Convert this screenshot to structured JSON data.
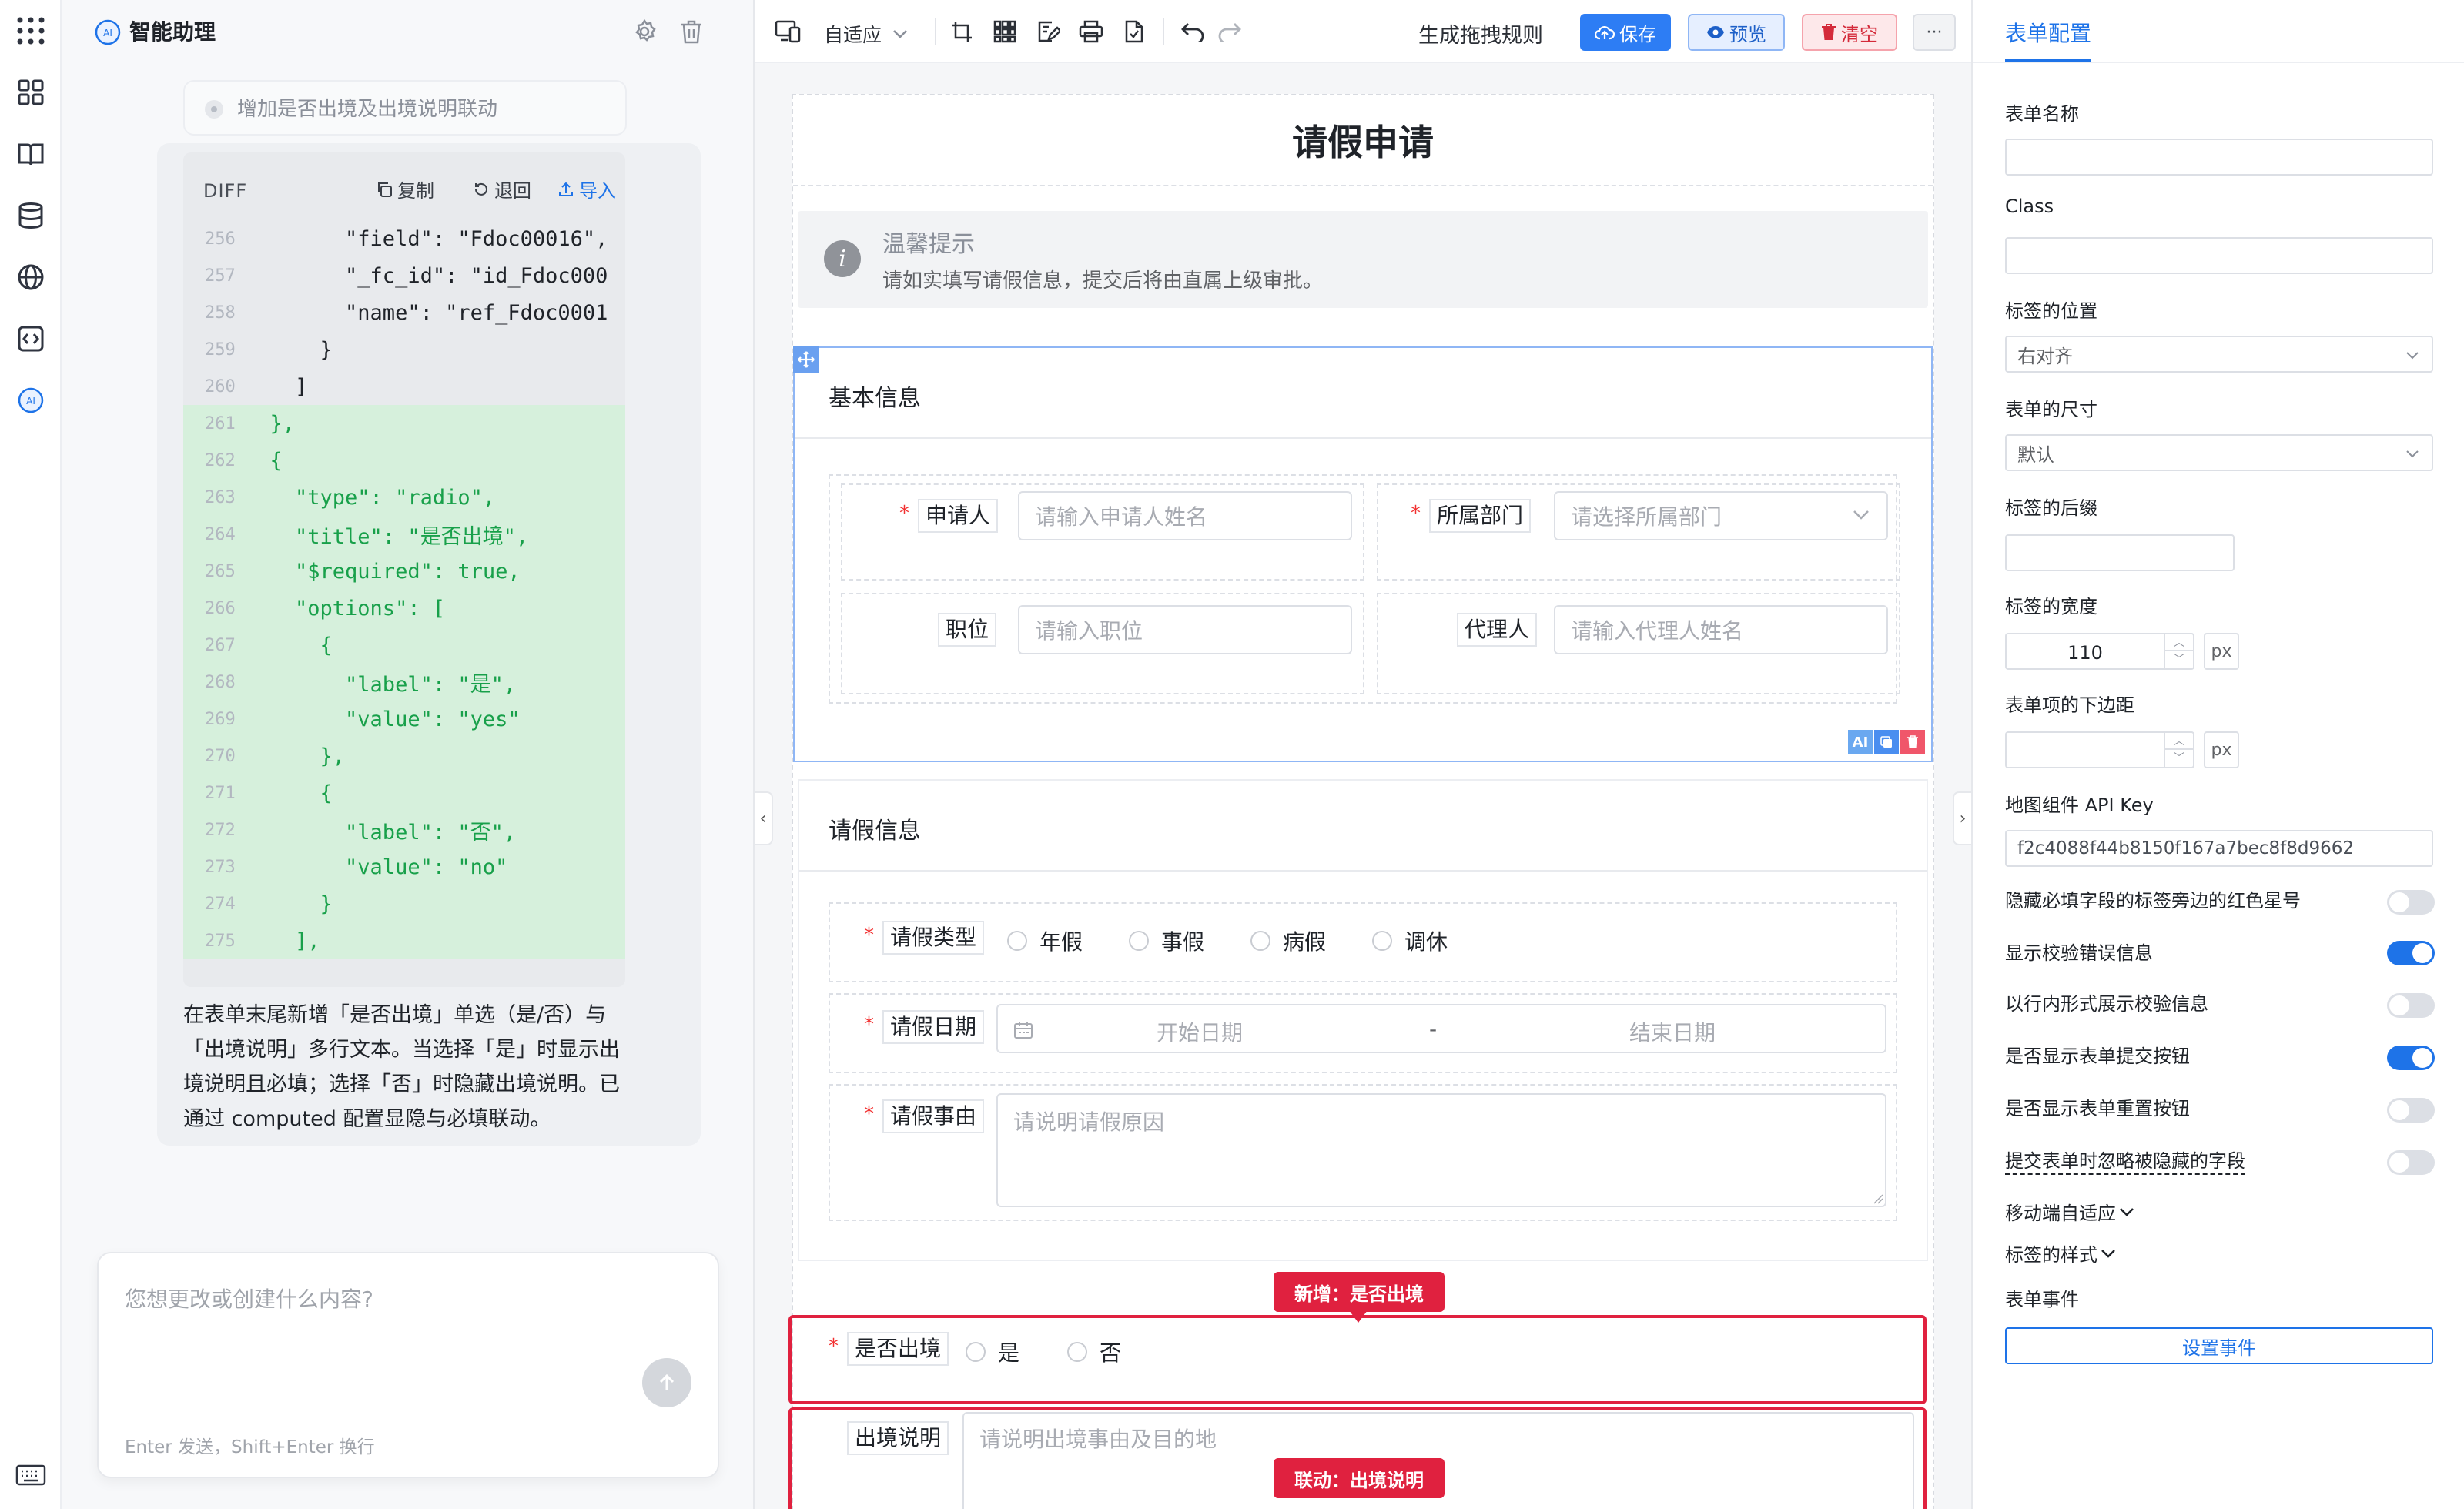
{
  "assistant": {
    "title": "智能助理",
    "prev_prompt": "增加是否出境及出境说明联动",
    "diff": {
      "label": "DIFF",
      "copy": "复制",
      "revert": "退回",
      "import": "导入",
      "lines": [
        {
          "n": "256",
          "t": "        \"field\": \"Fdoc00016\",",
          "added": false
        },
        {
          "n": "257",
          "t": "        \"_fc_id\": \"id_Fdoc000",
          "added": false
        },
        {
          "n": "258",
          "t": "        \"name\": \"ref_Fdoc0001",
          "added": false
        },
        {
          "n": "259",
          "t": "      }",
          "added": false
        },
        {
          "n": "260",
          "t": "    ]",
          "added": false
        },
        {
          "n": "261",
          "t": "  },",
          "added": true
        },
        {
          "n": "262",
          "t": "  {",
          "added": true
        },
        {
          "n": "263",
          "t": "    \"type\": \"radio\",",
          "added": true
        },
        {
          "n": "264",
          "t": "    \"title\": \"是否出境\",",
          "added": true
        },
        {
          "n": "265",
          "t": "    \"$required\": true,",
          "added": true
        },
        {
          "n": "266",
          "t": "    \"options\": [",
          "added": true
        },
        {
          "n": "267",
          "t": "      {",
          "added": true
        },
        {
          "n": "268",
          "t": "        \"label\": \"是\",",
          "added": true
        },
        {
          "n": "269",
          "t": "        \"value\": \"yes\"",
          "added": true
        },
        {
          "n": "270",
          "t": "      },",
          "added": true
        },
        {
          "n": "271",
          "t": "      {",
          "added": true
        },
        {
          "n": "272",
          "t": "        \"label\": \"否\",",
          "added": true
        },
        {
          "n": "273",
          "t": "        \"value\": \"no\"",
          "added": true
        },
        {
          "n": "274",
          "t": "      }",
          "added": true
        },
        {
          "n": "275",
          "t": "    ],",
          "added": true
        }
      ]
    },
    "message": "在表单末尾新增「是否出境」单选（是/否）与「出境说明」多行文本。当选择「是」时显示出境说明且必填；选择「否」时隐藏出境说明。已通过 computed 配置显隐与必填联动。",
    "input_placeholder": "您想更改或创建什么内容?",
    "input_hint": "Enter 发送，Shift+Enter 换行"
  },
  "toolbar": {
    "adapt": "自适应",
    "rule": "生成拖拽规则",
    "save": "保存",
    "preview": "预览",
    "clear": "清空",
    "more": "···"
  },
  "form": {
    "title": "请假申请",
    "tip_title": "温馨提示",
    "tip_text": "请如实填写请假信息，提交后将由直属上级审批。",
    "section1": "基本信息",
    "applicant_label": "申请人",
    "applicant_ph": "请输入申请人姓名",
    "dept_label": "所属部门",
    "dept_ph": "请选择所属部门",
    "position_label": "职位",
    "position_ph": "请输入职位",
    "agent_label": "代理人",
    "agent_ph": "请输入代理人姓名",
    "section2": "请假信息",
    "type_label": "请假类型",
    "type_options": [
      "年假",
      "事假",
      "病假",
      "调休"
    ],
    "date_label": "请假日期",
    "date_start": "开始日期",
    "date_sep": "-",
    "date_end": "结束日期",
    "reason_label": "请假事由",
    "reason_ph": "请说明请假原因",
    "badge_new": "新增：是否出境",
    "abroad_label": "是否出境",
    "abroad_yes": "是",
    "abroad_no": "否",
    "abroad_desc_label": "出境说明",
    "abroad_desc_ph": "请说明出境事由及目的地",
    "badge_link": "联动：出境说明",
    "tool_ai": "AI"
  },
  "props": {
    "tab": "表单配置",
    "form_name": "表单名称",
    "class": "Class",
    "label_pos": "标签的位置",
    "label_pos_val": "右对齐",
    "form_size": "表单的尺寸",
    "form_size_val": "默认",
    "label_suffix": "标签的后缀",
    "label_width": "标签的宽度",
    "label_width_val": "110",
    "unit": "px",
    "item_margin": "表单项的下边距",
    "map_key": "地图组件 API Key",
    "map_key_val": "f2c4088f44b8150f167a7bec8f8d9662",
    "hide_star": "隐藏必填字段的标签旁边的红色星号",
    "show_err": "显示校验错误信息",
    "inline_err": "以行内形式展示校验信息",
    "show_submit": "是否显示表单提交按钮",
    "show_reset": "是否显示表单重置按钮",
    "ignore_hidden": "提交表单时忽略被隐藏的字段",
    "mobile": "移动端自适应",
    "label_style": "标签的样式",
    "events": "表单事件",
    "set_event": "设置事件"
  },
  "colors": {
    "accent": "#1e73e8",
    "added_bg": "#d6f0dc",
    "added_text": "#18a04a",
    "danger": "#e0213f"
  }
}
